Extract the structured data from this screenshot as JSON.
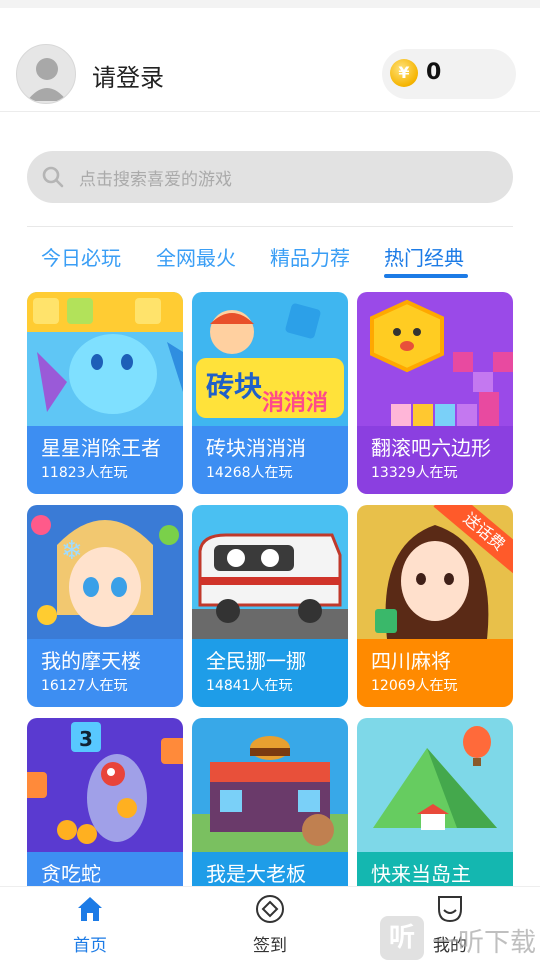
{
  "header": {
    "login_label": "请登录",
    "coin_symbol": "¥",
    "coin_count": "0"
  },
  "search": {
    "placeholder": "点击搜索喜爱的游戏"
  },
  "tabs": [
    {
      "label": "今日必玩",
      "active": false
    },
    {
      "label": "全网最火",
      "active": false
    },
    {
      "label": "精品力荐",
      "active": false
    },
    {
      "label": "热门经典",
      "active": true
    }
  ],
  "games": [
    {
      "name": "星星消除王者",
      "players": "11823人在玩",
      "art_label": "",
      "color": "#3d8ef2"
    },
    {
      "name": "砖块消消消",
      "players": "14268人在玩",
      "art_label": "砖块 消消消",
      "color": "#3d8ef2"
    },
    {
      "name": "翻滚吧六边形",
      "players": "13329人在玩",
      "art_label": "",
      "color": "#8b3fe0"
    },
    {
      "name": "我的摩天楼",
      "players": "16127人在玩",
      "art_label": "",
      "color": "#3d8ef2"
    },
    {
      "name": "全民挪一挪",
      "players": "14841人在玩",
      "art_label": "",
      "color": "#1e9de8"
    },
    {
      "name": "四川麻将",
      "players": "12069人在玩",
      "art_label": "",
      "badge": "送话费",
      "color": "#ff8a00"
    },
    {
      "name": "贪吃蛇",
      "players": "",
      "art_label": "",
      "color": "#3d8ef2"
    },
    {
      "name": "我是大老板",
      "players": "",
      "art_label": "FAST FOOD",
      "color": "#1e9de8"
    },
    {
      "name": "快来当岛主",
      "players": "",
      "art_label": "",
      "color": "#14b7b0"
    }
  ],
  "nav": [
    {
      "label": "首页",
      "active": true
    },
    {
      "label": "签到",
      "active": false
    },
    {
      "label": "我的",
      "active": false
    }
  ],
  "watermark": {
    "badge": "听",
    "text": "一听下载"
  },
  "colors": {
    "accent": "#1c7be6",
    "tab_text": "#3a9ef5",
    "badge": "#ff5a2a"
  }
}
